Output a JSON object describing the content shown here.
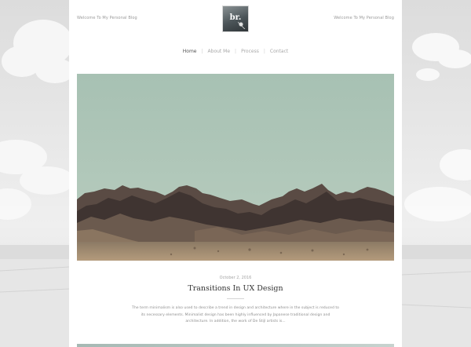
{
  "header": {
    "left_note": "Welcome To My Personal Blog",
    "right_note": "Welcome To My Personal Blog",
    "logo_text": "br."
  },
  "nav": {
    "items": [
      {
        "label": "Home"
      },
      {
        "label": "About Me"
      },
      {
        "label": "Process"
      },
      {
        "label": "Contact"
      }
    ],
    "separator": "|"
  },
  "post": {
    "date": "October 2, 2016",
    "title": "Transitions In UX Design",
    "excerpt": "The term minimalism is also used to describe a trend in design and architecture where in the subject is reduced to its necessary elements. Minimalist design has been highly influenced by Japanese traditional design and architecture. In addition, the work of De Stijl artists is..."
  },
  "colors": {
    "sky": "#a9c3b6",
    "mountain_dark": "#3d3330",
    "sand": "#b39a7c",
    "accent_strip": "#a6b9b4"
  }
}
